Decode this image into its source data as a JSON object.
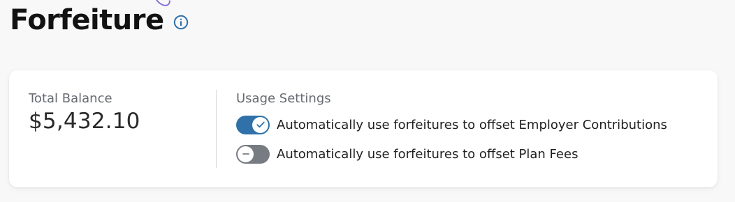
{
  "page": {
    "title": "Forfeiture"
  },
  "header": {
    "info_icon": "info-icon"
  },
  "balance": {
    "label": "Total Balance",
    "value": "$5,432.10"
  },
  "usage_settings": {
    "title": "Usage Settings",
    "items": [
      {
        "label": "Automatically use forfeitures to offset Employer Contributions",
        "enabled": true,
        "icon": "check-icon"
      },
      {
        "label": "Automatically use forfeitures to offset Plan Fees",
        "enabled": false,
        "icon": "minus-icon"
      }
    ]
  },
  "colors": {
    "page_background": "#f8f8f8",
    "card_background": "#ffffff",
    "accent": "#2f71a8",
    "toggle_off": "#777c82",
    "muted_text": "#666a70"
  }
}
